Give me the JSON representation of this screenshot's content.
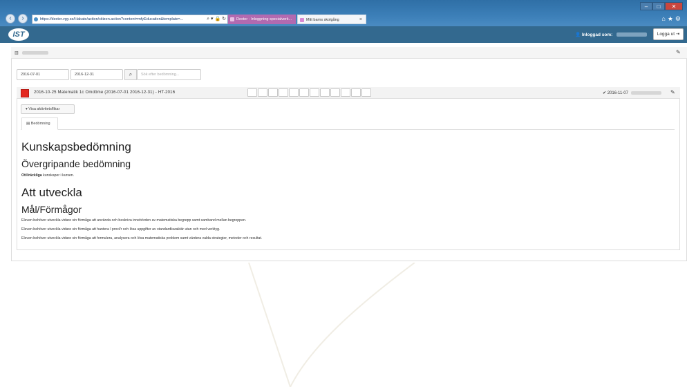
{
  "browser": {
    "url": "https://dexter.vgy.se/Hakate/action/citizen.action?content=mfyEducation&template=...",
    "tabs": [
      {
        "label": "Dexter - Inloggning specialverk..."
      },
      {
        "label": "Mitt barns skolgång"
      }
    ],
    "tab_close": "×",
    "win_controls": [
      "–",
      "□",
      "✕"
    ]
  },
  "header": {
    "logo": "IST",
    "logged_in_label": "Inloggad som:",
    "logout_label": "Logga ut"
  },
  "filters": {
    "date_from": "2016-07-01",
    "date_to": "2016-12-31",
    "search_placeholder": "Sök efter bedömning..."
  },
  "record": {
    "title": "2016-10-25 Matematik 1c Omdöme (2016-07-01 2016-12-31) - HT-2016",
    "date": "2016-11-07",
    "status_color": "#e3281f",
    "box_count": 12,
    "show_activities_label": "Visa aktivitetsflikar",
    "tab_label": "Bedömning"
  },
  "content": {
    "h1": "Kunskapsbedömning",
    "h2": "Övergripande bedömning",
    "summary_bold": "Otillräckliga",
    "summary_rest": " kunskaper i kursen.",
    "h3": "Att utveckla",
    "h4": "Mål/Förmågor",
    "lines": [
      "Eleven behöver utveckla vidare sin förmåga att använda och beskriva innebörden av matematiska begrepp samt samband mellan begreppen.",
      "Eleven behöver utveckla vidare sin förmåga att hantera l procl/r och lösa uppgifter av standardkaraktär utan och med verktyg.",
      "Eleven behöver utveckla vidare sin förmåga att formulera, analysera och lösa matematiska problem samt värdera valda strategier, metoder och resultat."
    ]
  },
  "colors": {
    "appbar": "#33698f",
    "accent_red": "#e3281f"
  }
}
